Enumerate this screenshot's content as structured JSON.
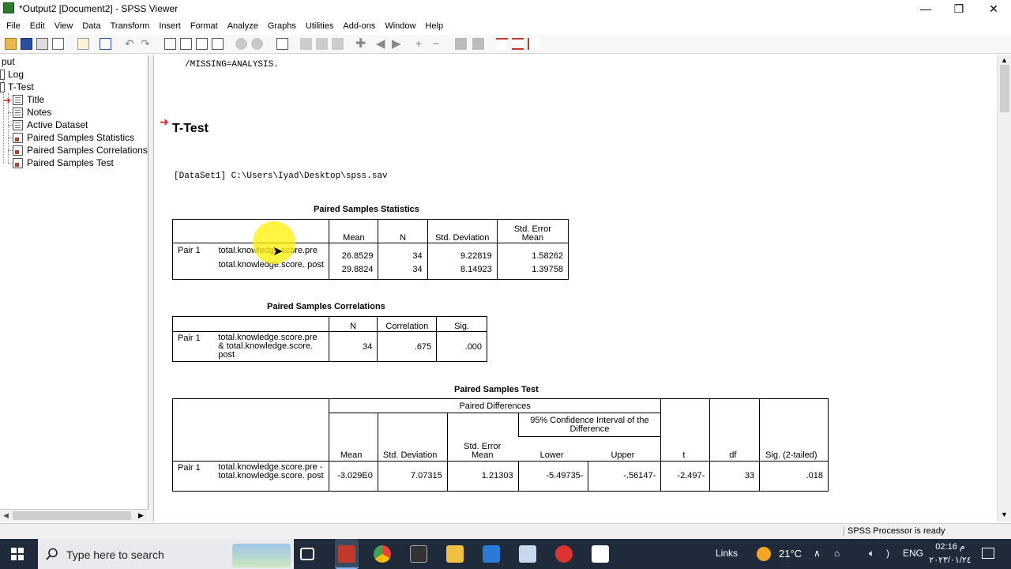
{
  "window": {
    "title": "*Output2 [Document2] - SPSS Viewer",
    "minimize": "—",
    "restore": "❐",
    "close": "✕"
  },
  "menu": [
    "File",
    "Edit",
    "View",
    "Data",
    "Transform",
    "Insert",
    "Format",
    "Analyze",
    "Graphs",
    "Utilities",
    "Add-ons",
    "Window",
    "Help"
  ],
  "outline": {
    "root": "put",
    "items": [
      {
        "label": "Log"
      },
      {
        "label": "T-Test"
      },
      {
        "label": "Title"
      },
      {
        "label": "Notes"
      },
      {
        "label": "Active Dataset"
      },
      {
        "label": "Paired Samples Statistics"
      },
      {
        "label": "Paired Samples Correlations"
      },
      {
        "label": "Paired Samples Test"
      }
    ]
  },
  "output": {
    "syntax_line": "/MISSING=ANALYSIS.",
    "heading": "T-Test",
    "dataset": "[DataSet1] C:\\Users\\Iyad\\Desktop\\spss.sav",
    "stats": {
      "caption": "Paired Samples Statistics",
      "headers": [
        "Mean",
        "N",
        "Std. Deviation",
        "Std. Error Mean"
      ],
      "pair": "Pair 1",
      "rows": [
        {
          "var": "total.knowledge.score.pre",
          "mean": "26.8529",
          "n": "34",
          "sd": "9.22819",
          "se": "1.58262"
        },
        {
          "var": "total.knowledge.score. post",
          "mean": "29.8824",
          "n": "34",
          "sd": "8.14923",
          "se": "1.39758"
        }
      ]
    },
    "corr": {
      "caption": "Paired Samples Correlations",
      "headers": [
        "N",
        "Correlation",
        "Sig."
      ],
      "pair": "Pair 1",
      "var": "total.knowledge.score.pre & total.knowledge.score. post",
      "n": "34",
      "r": ".675",
      "sig": ".000"
    },
    "test": {
      "caption": "Paired Samples Test",
      "group_header": "Paired Differences",
      "ci_header": "95% Confidence Interval of the Difference",
      "headers": [
        "Mean",
        "Std. Deviation",
        "Std. Error Mean",
        "Lower",
        "Upper",
        "t",
        "df",
        "Sig. (2-tailed)"
      ],
      "pair": "Pair 1",
      "var": "total.knowledge.score.pre - total.knowledge.score. post",
      "mean": "-3.029E0",
      "sd": "7.07315",
      "se": "1.21303",
      "lower": "-5.49735-",
      "upper": "-.56147-",
      "t": "-2.497-",
      "df": "33",
      "sig": ".018"
    }
  },
  "status": "SPSS Processor is ready",
  "taskbar": {
    "search_placeholder": "Type here to search",
    "links": "Links",
    "weather": "21°C",
    "lang": "ENG",
    "time": "02:16 م",
    "date": "٢٠٢٣/٠١/٢٤"
  },
  "colors": {
    "arrow": "#e02020",
    "taskbar": "#1f2b3a",
    "highlight": "#fff000"
  }
}
